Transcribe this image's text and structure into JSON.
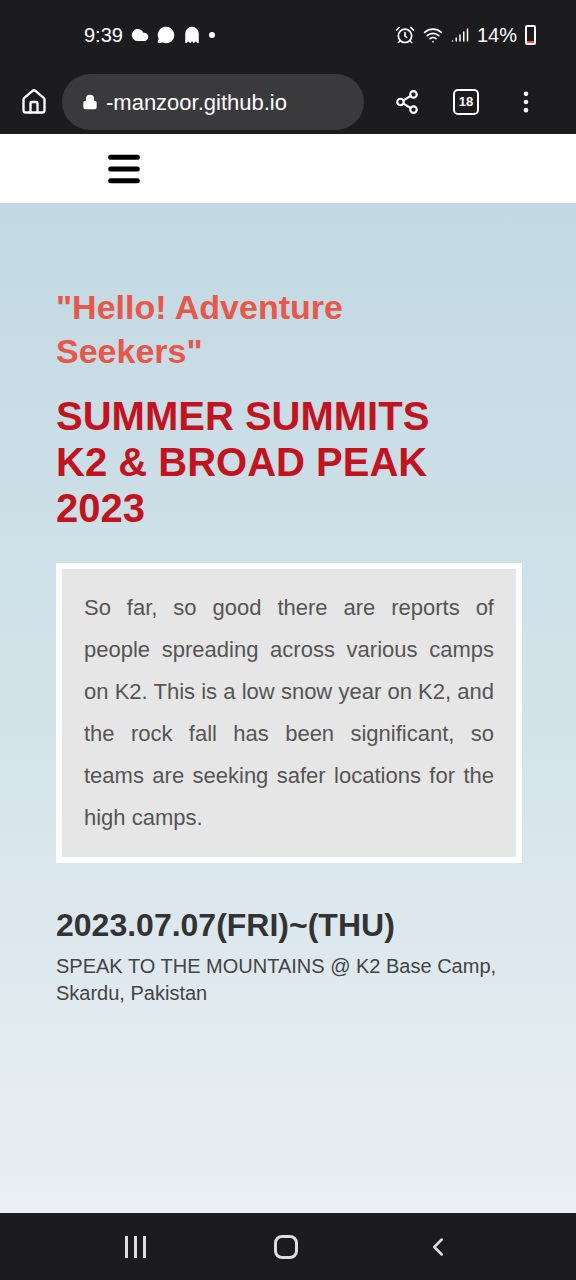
{
  "status_bar": {
    "time": "9:39",
    "battery": {
      "text": "14%",
      "level": 0.14
    }
  },
  "browser": {
    "url": "-manzoor.github.io",
    "tab_count": "18"
  },
  "page": {
    "greeting": "\"Hello! Adventure Seekers\"",
    "title_lines": [
      "SUMMER SUMMITS",
      "K2 & BROAD PEAK",
      "2023"
    ],
    "description": "So far, so good there are reports of people spreading across various camps on K2. This is a low snow year on K2, and the rock fall has been significant, so teams are seeking safer locations for the high camps.",
    "date": "2023.07.07(FRI)~(THU)",
    "location": "SPEAK TO THE MOUNTAINS @ K2 Base Camp, Skardu, Pakistan"
  }
}
